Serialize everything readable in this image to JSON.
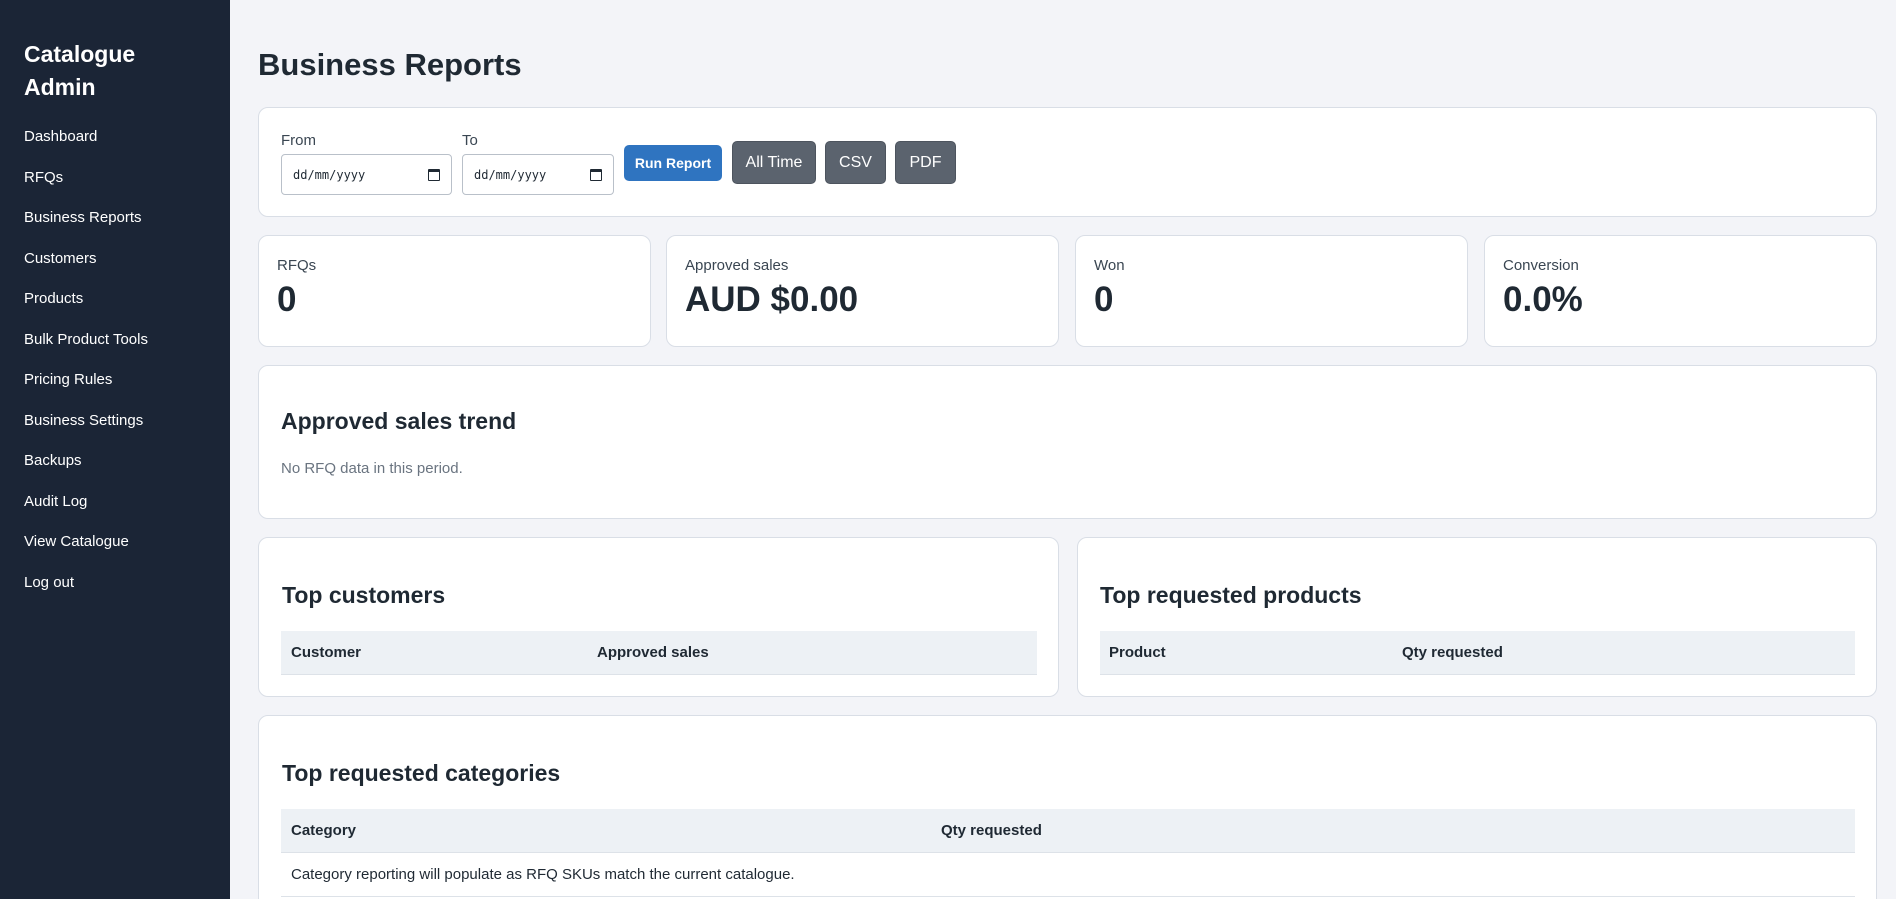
{
  "sidebar": {
    "brand": "Catalogue Admin",
    "items": [
      {
        "label": "Dashboard"
      },
      {
        "label": "RFQs"
      },
      {
        "label": "Business Reports"
      },
      {
        "label": "Customers"
      },
      {
        "label": "Products"
      },
      {
        "label": "Bulk Product Tools"
      },
      {
        "label": "Pricing Rules"
      },
      {
        "label": "Business Settings"
      },
      {
        "label": "Backups"
      },
      {
        "label": "Audit Log"
      },
      {
        "label": "View Catalogue"
      },
      {
        "label": "Log out"
      }
    ]
  },
  "page": {
    "title": "Business Reports"
  },
  "filters": {
    "from_label": "From",
    "from_value": "dd/mm/yyyy",
    "to_label": "To",
    "to_value": "dd/mm/yyyy",
    "run_report": "Run Report",
    "all_time": "All Time",
    "csv": "CSV",
    "pdf": "PDF"
  },
  "stats": [
    {
      "label": "RFQs",
      "value": "0"
    },
    {
      "label": "Approved sales",
      "value": "AUD $0.00"
    },
    {
      "label": "Won",
      "value": "0"
    },
    {
      "label": "Conversion",
      "value": "0.0%"
    }
  ],
  "trend": {
    "title": "Approved sales trend",
    "empty_text": "No RFQ data in this period."
  },
  "top_customers": {
    "title": "Top customers",
    "columns": [
      "Customer",
      "Approved sales"
    ]
  },
  "top_products": {
    "title": "Top requested products",
    "columns": [
      "Product",
      "Qty requested"
    ]
  },
  "top_categories": {
    "title": "Top requested categories",
    "columns": [
      "Category",
      "Qty requested"
    ],
    "empty_text": "Category reporting will populate as RFQ SKUs match the current catalogue."
  },
  "colors": {
    "sidebar_bg": "#1b2536",
    "page_bg": "#f3f4f8",
    "primary": "#2f74c0",
    "secondary": "#5b636e"
  }
}
